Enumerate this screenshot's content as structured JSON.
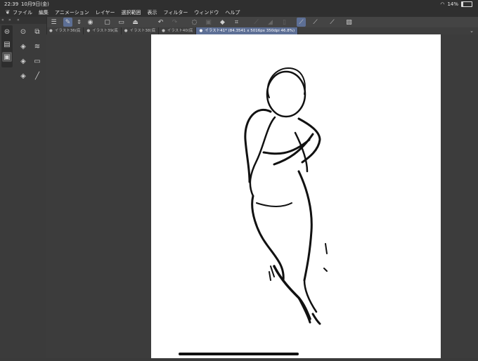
{
  "status": {
    "time": "22:39",
    "date": "10月9日(金)",
    "battery": "14%",
    "battery_level": 0.14
  },
  "menu": [
    "ファイル",
    "編集",
    "アニメーション",
    "レイヤー",
    "選択範囲",
    "表示",
    "フィルター",
    "ウィンドウ",
    "ヘルプ"
  ],
  "tabs": [
    {
      "label": "イラスト36(底"
    },
    {
      "label": "イラスト39(底"
    },
    {
      "label": "イラスト38(底"
    },
    {
      "label": "イラスト40(底"
    },
    {
      "label": "イラスト41* (84.3541 x 5016px 350dpi 46.8%)"
    }
  ],
  "toolbar_icons": [
    "menu-icon",
    "pen-icon",
    "updown-icon",
    "record-icon",
    "new-icon",
    "open-icon",
    "save-icon",
    "undo-icon",
    "redo-icon",
    "lasso-icon",
    "copy-icon",
    "fill-icon",
    "crop-icon",
    "snap-icon",
    "ruler-icon",
    "settings-icon"
  ],
  "accent_color": "#5d6f95"
}
